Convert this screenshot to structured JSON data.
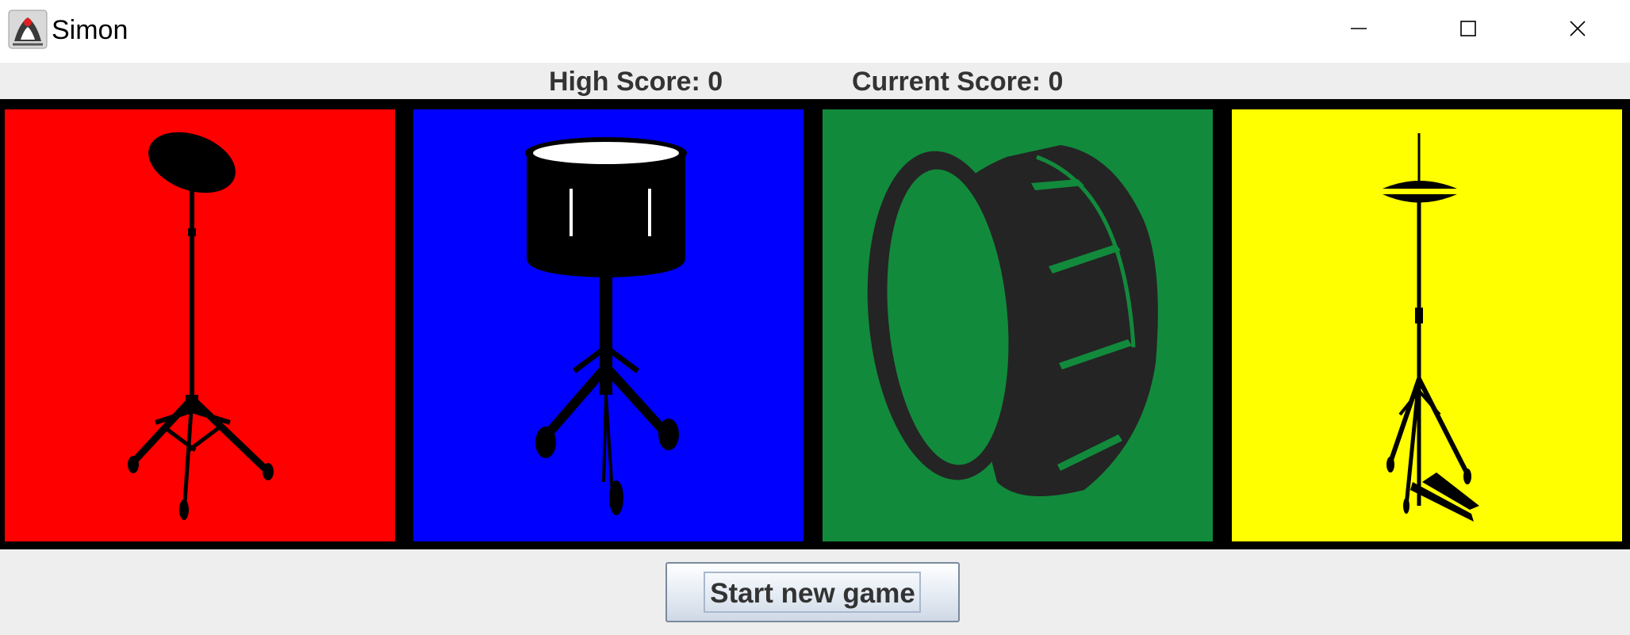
{
  "window": {
    "title": "Simon",
    "controls": {
      "minimize_icon": "minimize-icon",
      "maximize_icon": "maximize-icon",
      "close_icon": "close-icon"
    }
  },
  "scores": {
    "high_score": "High Score: 0",
    "current_score": "Current Score: 0"
  },
  "pads": [
    {
      "color": "#ff0000",
      "icon": "crash-cymbal-icon"
    },
    {
      "color": "#0000ff",
      "icon": "snare-drum-icon"
    },
    {
      "color": "#128a3c",
      "icon": "bass-drum-icon"
    },
    {
      "color": "#ffff00",
      "icon": "hi-hat-icon"
    }
  ],
  "controls": {
    "start_label": "Start new game"
  }
}
